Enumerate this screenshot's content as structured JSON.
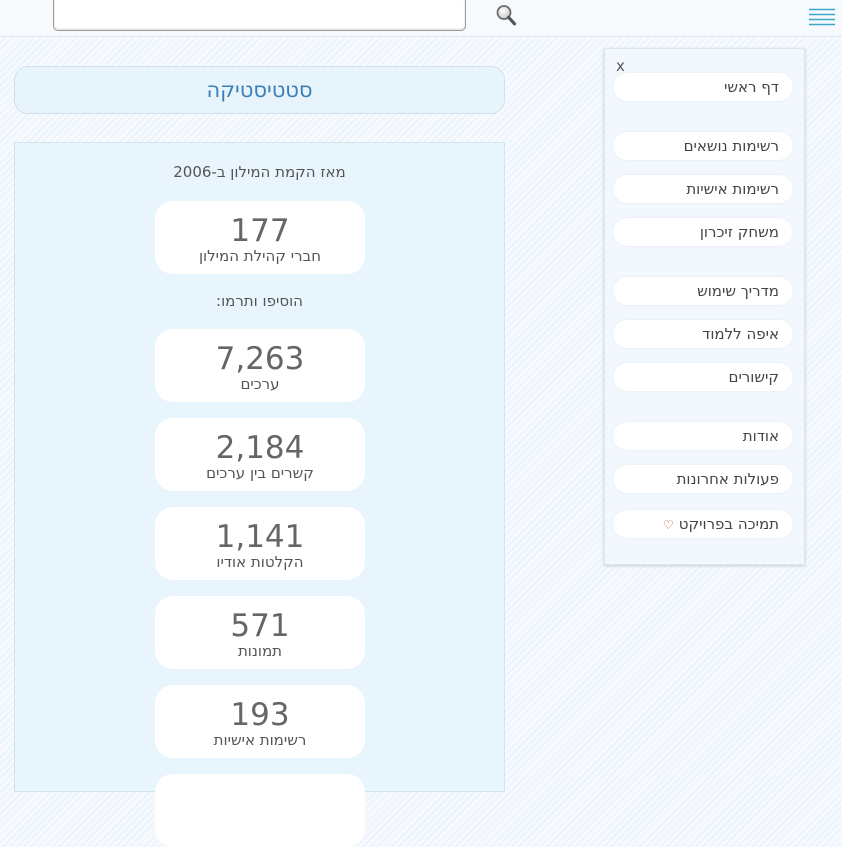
{
  "search": {
    "placeholder": "",
    "value": ""
  },
  "menu": {
    "close_label": "x",
    "items": [
      {
        "label": "דף ראשי"
      },
      {
        "label": "רשימות נושאים"
      },
      {
        "label": "רשימות אישיות"
      },
      {
        "label": "משחק זיכרון"
      },
      {
        "label": "מדריך שימוש"
      },
      {
        "label": "איפה ללמוד"
      },
      {
        "label": "קישורים"
      },
      {
        "label": "אודות"
      },
      {
        "label": "פעולות אחרונות"
      },
      {
        "label": "תמיכה בפרויקט"
      }
    ]
  },
  "page": {
    "title": "סטטיסטיקה",
    "since_text": "מאז הקמת המילון ב-2006",
    "contrib_text": "הוסיפו ותרמו:"
  },
  "stats": [
    {
      "number": "177",
      "label": "חברי קהילת המילון"
    },
    {
      "number": "7,263",
      "label": "ערכים"
    },
    {
      "number": "2,184",
      "label": "קשרים בין ערכים"
    },
    {
      "number": "1,141",
      "label": "הקלטות אודיו"
    },
    {
      "number": "571",
      "label": "תמונות"
    },
    {
      "number": "193",
      "label": "רשימות אישיות"
    }
  ],
  "colors": {
    "accent": "#3a7fb5",
    "menu_icon": "#3aa7c9",
    "heart": "#c0392b"
  },
  "icons": {
    "search": "magnifier-icon",
    "menu": "hamburger-icon",
    "close": "close-icon",
    "heart": "heart-icon"
  }
}
